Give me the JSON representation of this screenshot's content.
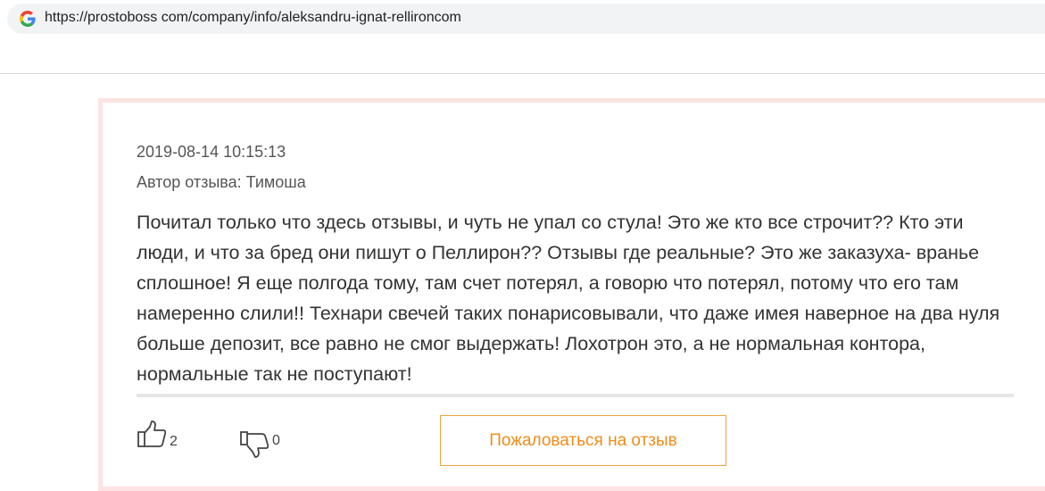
{
  "browser": {
    "url": "https://prostoboss com/company/info/aleksandru-ignat-rellironcom",
    "favicon": "google-g-icon"
  },
  "review": {
    "date": "2019-08-14 10:15:13",
    "author": "Автор отзыва: Тимоша",
    "text": "Почитал только что здесь отзывы, и чуть не упал со стула! Это же кто все строчит?? Кто эти люди, и что за бред они пишут о Пеллирон?? Отзывы где реальные? Это же заказуха- вранье сплошное! Я еще полгода тому, там счет потерял, а говорю что потерял, потому что его там намеренно слили!! Технари свечей таких понарисовывали, что даже имея наверное на два нуля больше депозит, все равно не смог выдержать! Лохотрон это, а не нормальная контора, нормальные так не поступают!",
    "likes": "2",
    "dislikes": "0",
    "complain_label": "Пожаловаться на отзыв"
  },
  "colors": {
    "accent": "#f08c1a",
    "card_border": "#fde3e3"
  }
}
